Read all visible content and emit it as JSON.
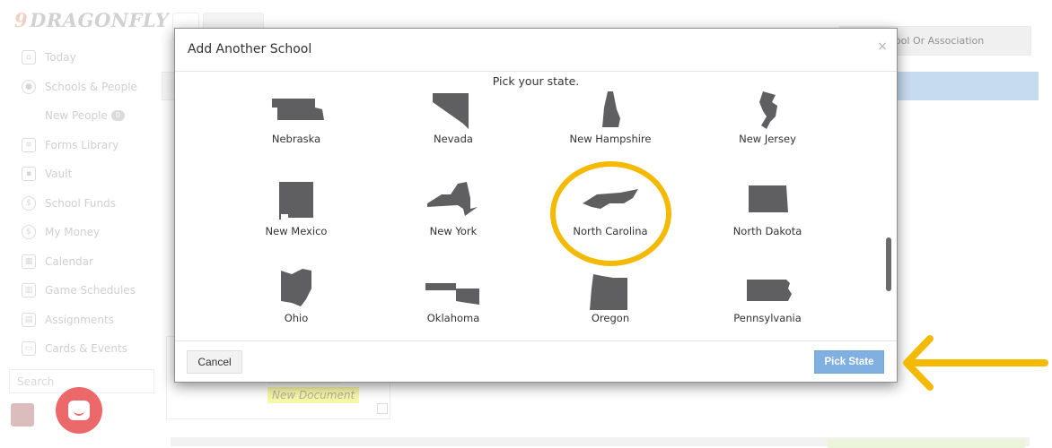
{
  "app": {
    "logo": "DRAGONFLY",
    "logo_mark": "9",
    "connect_button": "ct To School Or Association"
  },
  "sidebar": {
    "items": [
      {
        "label": "Today",
        "icon": "home-icon"
      },
      {
        "label": "Schools & People",
        "icon": "person-icon"
      },
      {
        "label": "New People",
        "icon": "",
        "badge": "0"
      },
      {
        "label": "Forms Library",
        "icon": "forms-icon"
      },
      {
        "label": "Vault",
        "icon": "vault-icon"
      },
      {
        "label": "School Funds",
        "icon": "dollar-icon"
      },
      {
        "label": "My Money",
        "icon": "dollar-icon"
      },
      {
        "label": "Calendar",
        "icon": "calendar-icon"
      },
      {
        "label": "Game Schedules",
        "icon": "schedule-icon"
      },
      {
        "label": "Assignments",
        "icon": "assignments-icon"
      },
      {
        "label": "Cards & Events",
        "icon": "cards-icon"
      }
    ],
    "search_placeholder": "Search"
  },
  "background": {
    "new_document": "New Document"
  },
  "modal": {
    "title": "Add Another School",
    "close": "×",
    "prompt": "Pick your state.",
    "states": [
      {
        "name": "Nebraska",
        "icon": "nebraska-icon"
      },
      {
        "name": "Nevada",
        "icon": "nevada-icon"
      },
      {
        "name": "New Hampshire",
        "icon": "new-hampshire-icon"
      },
      {
        "name": "New Jersey",
        "icon": "new-jersey-icon"
      },
      {
        "name": "New Mexico",
        "icon": "new-mexico-icon"
      },
      {
        "name": "New York",
        "icon": "new-york-icon"
      },
      {
        "name": "North Carolina",
        "icon": "north-carolina-icon",
        "highlighted": true
      },
      {
        "name": "North Dakota",
        "icon": "north-dakota-icon"
      },
      {
        "name": "Ohio",
        "icon": "ohio-icon"
      },
      {
        "name": "Oklahoma",
        "icon": "oklahoma-icon"
      },
      {
        "name": "Oregon",
        "icon": "oregon-icon"
      },
      {
        "name": "Pennsylvania",
        "icon": "pennsylvania-icon"
      }
    ],
    "cancel_label": "Cancel",
    "pick_label": "Pick State"
  },
  "colors": {
    "state_fill": "#5f5f62",
    "annotation": "#f3b903",
    "primary_button": "#7fb0e1"
  }
}
